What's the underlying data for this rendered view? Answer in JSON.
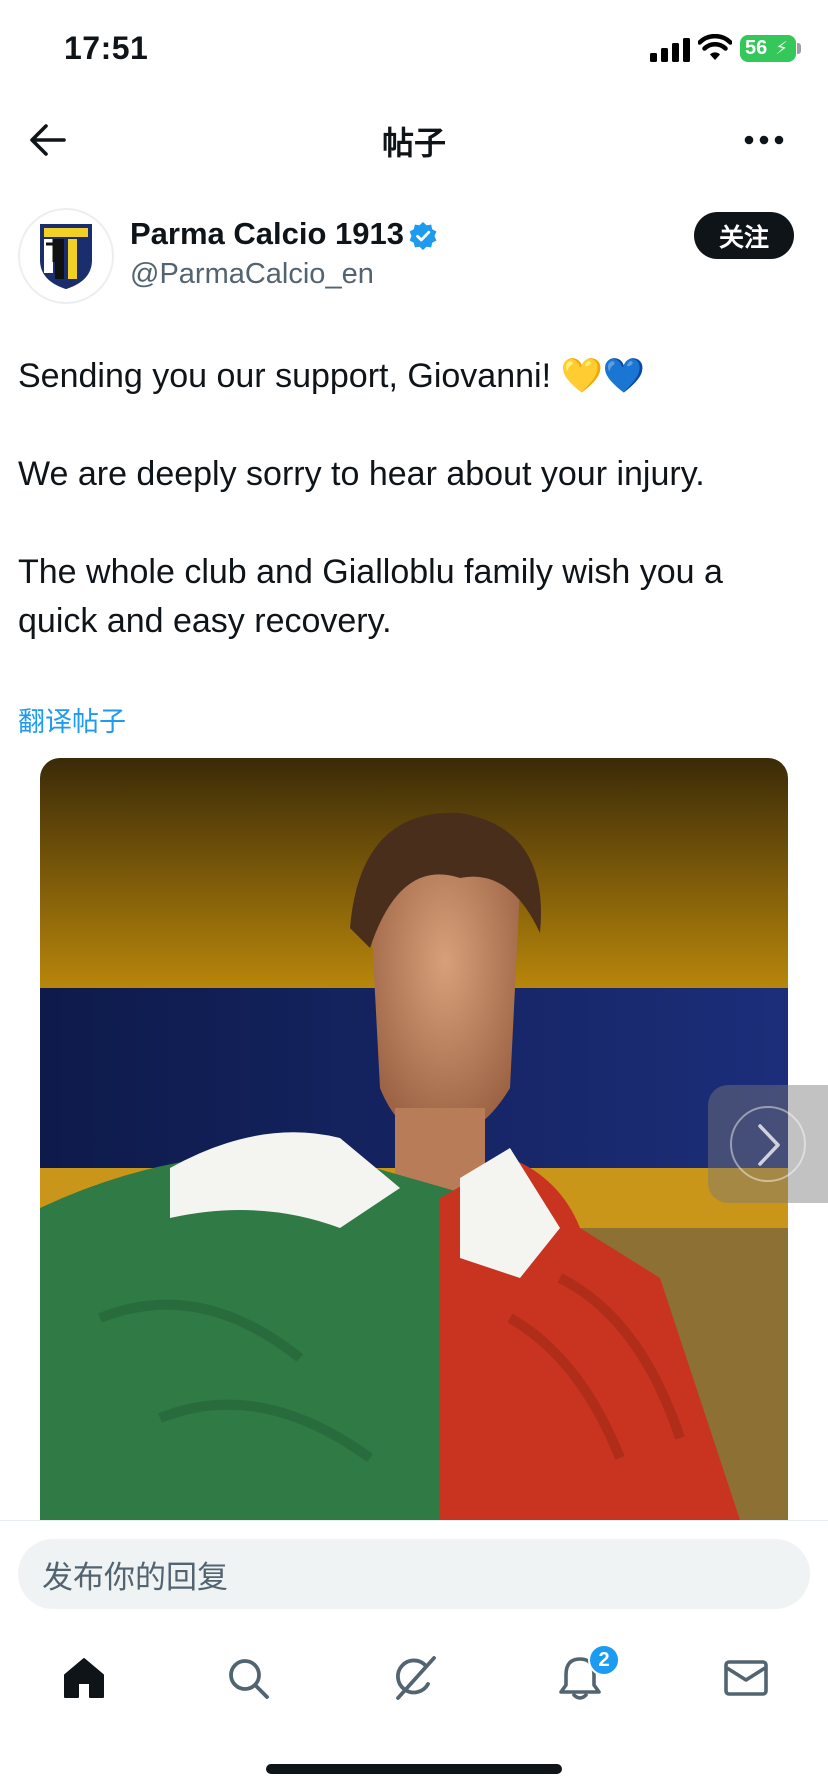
{
  "status_bar": {
    "time": "17:51",
    "battery": "56"
  },
  "header": {
    "title": "帖子"
  },
  "author": {
    "display_name": "Parma Calcio 1913",
    "handle": "@ParmaCalcio_en",
    "verified": true,
    "follow_label": "关注"
  },
  "post": {
    "line1": "Sending you our support, Giovanni! ",
    "line1_emojis": [
      "💛",
      "💙"
    ],
    "line2": "We are deeply sorry to hear about your injury.",
    "line3": "The whole club and Gialloblu family wish you a quick and easy recovery.",
    "translate_label": "翻译帖子"
  },
  "reply": {
    "placeholder": "发布你的回复"
  },
  "tab_bar": {
    "items": [
      "home-icon",
      "search-icon",
      "grok-icon",
      "notifications-icon",
      "messages-icon"
    ],
    "notifications_badge": "2"
  },
  "colors": {
    "accent": "#1d9bf0",
    "text": "#0f1419",
    "secondary": "#536471",
    "battery": "#34c759"
  }
}
